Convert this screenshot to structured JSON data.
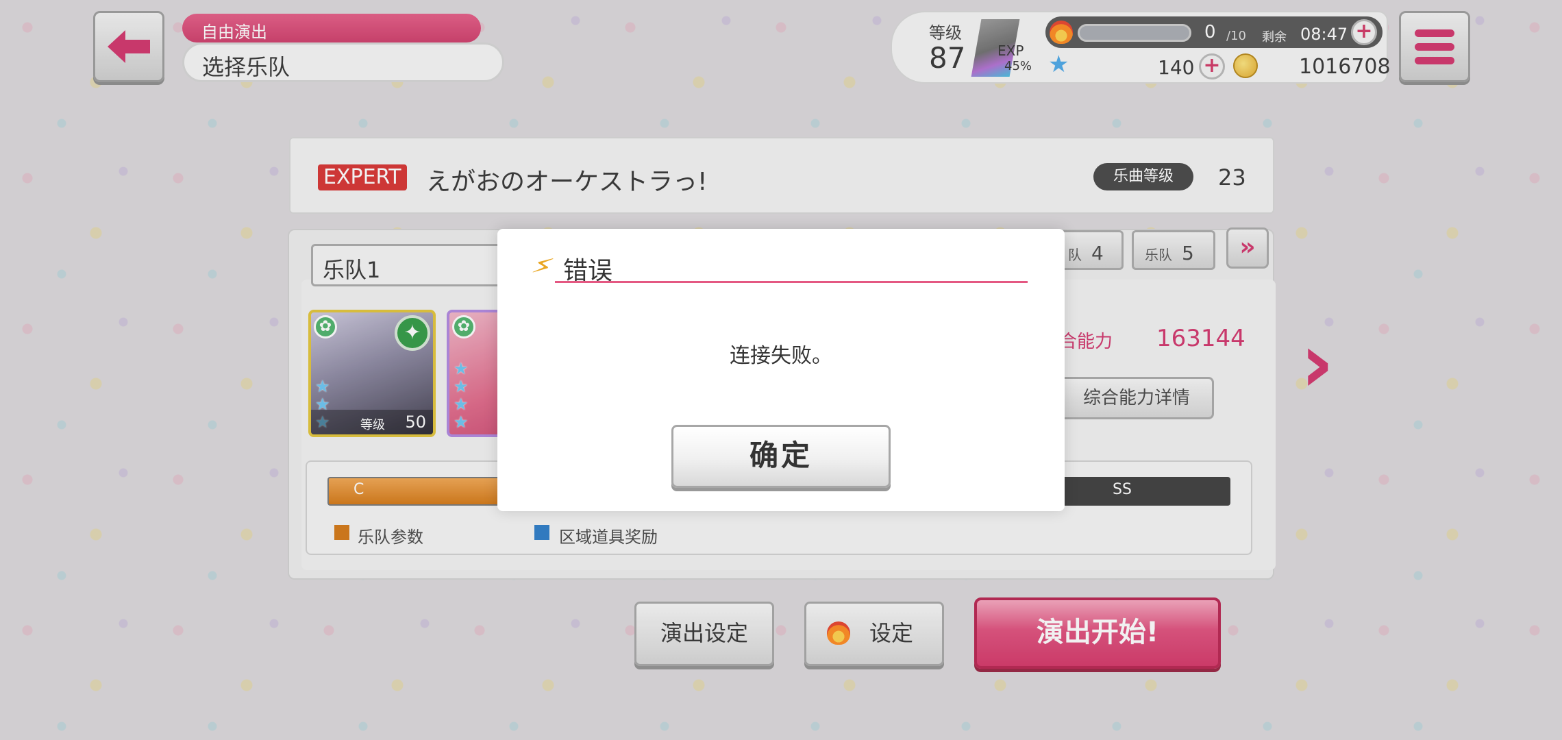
{
  "header": {
    "mode_label": "自由演出",
    "page_title": "选择乐队"
  },
  "status": {
    "level_label": "等级",
    "level_value": "87",
    "exp_label": "EXP",
    "exp_percent": "45%",
    "stamina_value": "0",
    "stamina_max": "/10",
    "remain_label": "剩余",
    "remain_time": "08:47",
    "stars": "140",
    "coins": "1016708"
  },
  "song": {
    "difficulty": "EXPERT",
    "title": "えがおのオーケストラっ!",
    "level_label": "乐曲等级",
    "level_value": "23"
  },
  "band": {
    "name": "乐队1",
    "tabs": [
      {
        "label": "队",
        "num": "4"
      },
      {
        "label": "乐队",
        "num": "5"
      }
    ],
    "next_tabs_icon": "»",
    "cards": [
      {
        "level_label": "等级",
        "level": "50"
      },
      {
        "level_label": "",
        "level": ""
      }
    ],
    "power_label": "合能力",
    "power_value": "163144",
    "power_detail_button": "综合能力详情"
  },
  "gauge": {
    "left_rank": "C",
    "right_rank": "SS",
    "legend": [
      {
        "label": "乐队参数",
        "color": "#d47712"
      },
      {
        "label": "区域道具奖励",
        "color": "#2a7bc8"
      }
    ]
  },
  "buttons": {
    "live_settings": "演出设定",
    "settings": "设定",
    "start": "演出开始!"
  },
  "dialog": {
    "title": "错误",
    "message": "连接失败。",
    "ok": "确定"
  },
  "colors": {
    "accent": "#d2326a",
    "expert": "#d7302f"
  }
}
